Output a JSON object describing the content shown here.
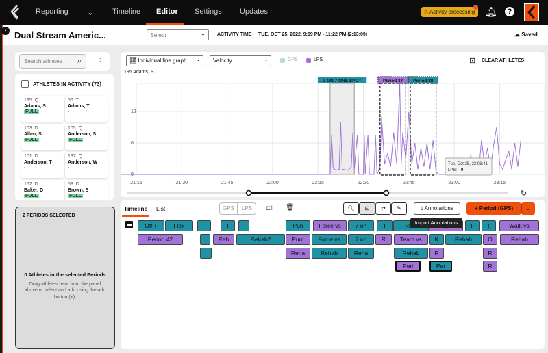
{
  "topbar": {
    "nav": [
      "Reporting",
      "Timeline",
      "Editor",
      "Settings",
      "Updates"
    ],
    "active": "Editor",
    "activity": "Activity processing",
    "notification_count": "1",
    "accent": "#f04e0c"
  },
  "header": {
    "title": "Dual Stream Americ...",
    "select_placeholder": "Select",
    "activity_time_label": "ACTIVITY TIME",
    "activity_time": "TUE, OCT 25, 2022, 9:09 PM - 11:22 PM (2:13:09)",
    "saved": "Saved"
  },
  "sidebar": {
    "search_placeholder": "Search athletes",
    "athletes_header": "ATHLETES IN ACTIVITY",
    "athletes_count": "(73)",
    "athletes": [
      {
        "num": "195. Q",
        "name": "Adams, S",
        "status": "FULL"
      },
      {
        "num": "56. T",
        "name": "Adams, T",
        "status": "-"
      },
      {
        "num": "103. D",
        "name": "Allen, S",
        "status": "FULL"
      },
      {
        "num": "105. Q",
        "name": "Anderson, S",
        "status": "FULL"
      },
      {
        "num": "101. D",
        "name": "Anderson, T",
        "status": "-"
      },
      {
        "num": "197. Q",
        "name": "Anderson, W",
        "status": "-"
      },
      {
        "num": "162. D",
        "name": "Baker, D",
        "status": "FULL"
      },
      {
        "num": "53. D",
        "name": "Brown, S",
        "status": "FULL"
      }
    ],
    "periods_selected": "2 PERIODS SELECTED",
    "empty_title": "0 Athletes in the selected Periods",
    "empty_desc": "Drag athletes here from the panel above or select and add using the add button (+)."
  },
  "chart_controls": {
    "graph_type": "Individual line graph",
    "metric": "Velocity",
    "legend": [
      {
        "label": "GPS",
        "color": "#b9d9dc"
      },
      {
        "label": "LPS",
        "color": "#a173d9"
      }
    ],
    "clear": "CLEAR ATHLETES",
    "athlete": "195 Adams, S"
  },
  "chart_data": {
    "type": "line",
    "series": [
      {
        "name": "LPS",
        "color": "#a173d9"
      }
    ],
    "x_ticks": [
      "21:15",
      "21:30",
      "21:45",
      "22:00",
      "22:15",
      "22:30",
      "22:45",
      "23:00",
      "23:15"
    ],
    "y_ticks": [
      "0",
      "6",
      "12"
    ],
    "ylim": [
      0,
      18
    ],
    "points": [
      [
        "21:09",
        0
      ],
      [
        "22:19",
        0
      ],
      [
        "22:19.5",
        7.5
      ],
      [
        "22:20",
        1.2
      ],
      [
        "22:21",
        0.8
      ],
      [
        "22:22",
        1
      ],
      [
        "22:22.5",
        10
      ],
      [
        "22:23",
        1
      ],
      [
        "22:25",
        0.8
      ],
      [
        "22:26",
        1.5
      ],
      [
        "22:26.5",
        8
      ],
      [
        "22:27",
        1
      ],
      [
        "22:28",
        7.5
      ],
      [
        "22:28.5",
        0
      ],
      [
        "22:30",
        0
      ],
      [
        "22:30.3",
        7.5
      ],
      [
        "22:30.6",
        0
      ],
      [
        "22:31.5",
        7.5
      ],
      [
        "22:32",
        0
      ],
      [
        "22:33.5",
        0
      ],
      [
        "22:34",
        7.5
      ],
      [
        "22:34.5",
        0
      ],
      [
        "22:35.5",
        1.5
      ],
      [
        "22:36",
        11
      ],
      [
        "22:37",
        2
      ],
      [
        "22:38",
        4
      ],
      [
        "22:39",
        1.5
      ],
      [
        "22:40",
        8
      ],
      [
        "22:41",
        2
      ],
      [
        "22:42",
        17.5
      ],
      [
        "22:42.5",
        2
      ],
      [
        "22:43",
        8
      ],
      [
        "22:44",
        3
      ],
      [
        "22:45",
        12
      ],
      [
        "22:46",
        2
      ],
      [
        "22:47",
        6
      ],
      [
        "22:48",
        1
      ],
      [
        "22:49",
        5
      ],
      [
        "22:50",
        1.5
      ],
      [
        "22:51",
        6
      ],
      [
        "22:52",
        1
      ],
      [
        "22:53",
        6.5
      ],
      [
        "22:54",
        0.5
      ],
      [
        "22:55",
        0
      ],
      [
        "23:05",
        0
      ],
      [
        "23:05.5",
        4
      ],
      [
        "23:06",
        0
      ],
      [
        "23:08",
        0
      ],
      [
        "23:09",
        6.5
      ],
      [
        "23:10",
        2
      ],
      [
        "23:11",
        5
      ],
      [
        "23:12",
        1
      ],
      [
        "23:13",
        5.5
      ],
      [
        "23:14",
        9
      ],
      [
        "23:15",
        2
      ],
      [
        "23:16",
        1
      ],
      [
        "23:18",
        4.5
      ],
      [
        "23:19",
        1
      ],
      [
        "23:20",
        6
      ],
      [
        "23:21",
        1.5
      ],
      [
        "23:22",
        6.5
      ]
    ],
    "shaded": {
      "label": "7 ON 7 ONE SPOT",
      "start": "22:19",
      "end": "22:27"
    },
    "periods": [
      {
        "label": "Period 37",
        "start": "22:35.5",
        "end": "22:44",
        "color": "#a173d9"
      },
      {
        "label": "Period 38",
        "start": "22:45.5",
        "end": "22:54",
        "color": "#1f93a5"
      }
    ],
    "tooltip": {
      "time": "Tue, Oct 25, 23:06:41",
      "label": "LPS:",
      "value": "0"
    }
  },
  "timeline": {
    "tabs": [
      "Timeline",
      "List"
    ],
    "active_tab": "Timeline",
    "toggle": [
      "GPS",
      "LPS"
    ],
    "annotations": "Annotations",
    "tooltip": "Import Annotations",
    "add_period": "Period (GPS)",
    "blocks": [
      {
        "l": "Off +",
        "c": "t"
      },
      {
        "l": "Flex",
        "c": "t"
      },
      {
        "l": "`",
        "c": "t"
      },
      {
        "l": "I",
        "c": "t"
      },
      {
        "l": "",
        "c": "t"
      },
      {
        "l": "Pun",
        "c": "t"
      },
      {
        "l": "Force vs",
        "c": "p"
      },
      {
        "l": "7 on",
        "c": "t"
      },
      {
        "l": "T",
        "c": "t"
      },
      {
        "l": "Team",
        "c": "t"
      },
      {
        "l": "",
        "c": "p"
      },
      {
        "l": "F",
        "c": "t"
      },
      {
        "l": "(",
        "c": "t"
      },
      {
        "l": "Walk vs",
        "c": "p"
      },
      {
        "l": "Period 42",
        "c": "p"
      },
      {
        "l": "",
        "c": "t"
      },
      {
        "l": "Reh",
        "c": "p"
      },
      {
        "l": "Rehab2",
        "c": "t"
      },
      {
        "l": "Punt",
        "c": "p"
      },
      {
        "l": "Force vs",
        "c": "t"
      },
      {
        "l": "7 on",
        "c": "t"
      },
      {
        "l": "R",
        "c": "p"
      },
      {
        "l": "Team vs",
        "c": "p"
      },
      {
        "l": "K",
        "c": "t"
      },
      {
        "l": "Rehab",
        "c": "t"
      },
      {
        "l": "O",
        "c": "p"
      },
      {
        "l": "Rehab",
        "c": "p"
      },
      {
        "l": "",
        "c": "t"
      },
      {
        "l": "Reha",
        "c": "p"
      },
      {
        "l": "Rehab",
        "c": "t"
      },
      {
        "l": "Reha",
        "c": "t"
      },
      {
        "l": "Rehab",
        "c": "t"
      },
      {
        "l": "R",
        "c": "p"
      },
      {
        "l": "R",
        "c": "p"
      },
      {
        "l": "Peri",
        "c": "p"
      },
      {
        "l": "Per",
        "c": "t"
      },
      {
        "l": "R",
        "c": "p"
      }
    ]
  }
}
